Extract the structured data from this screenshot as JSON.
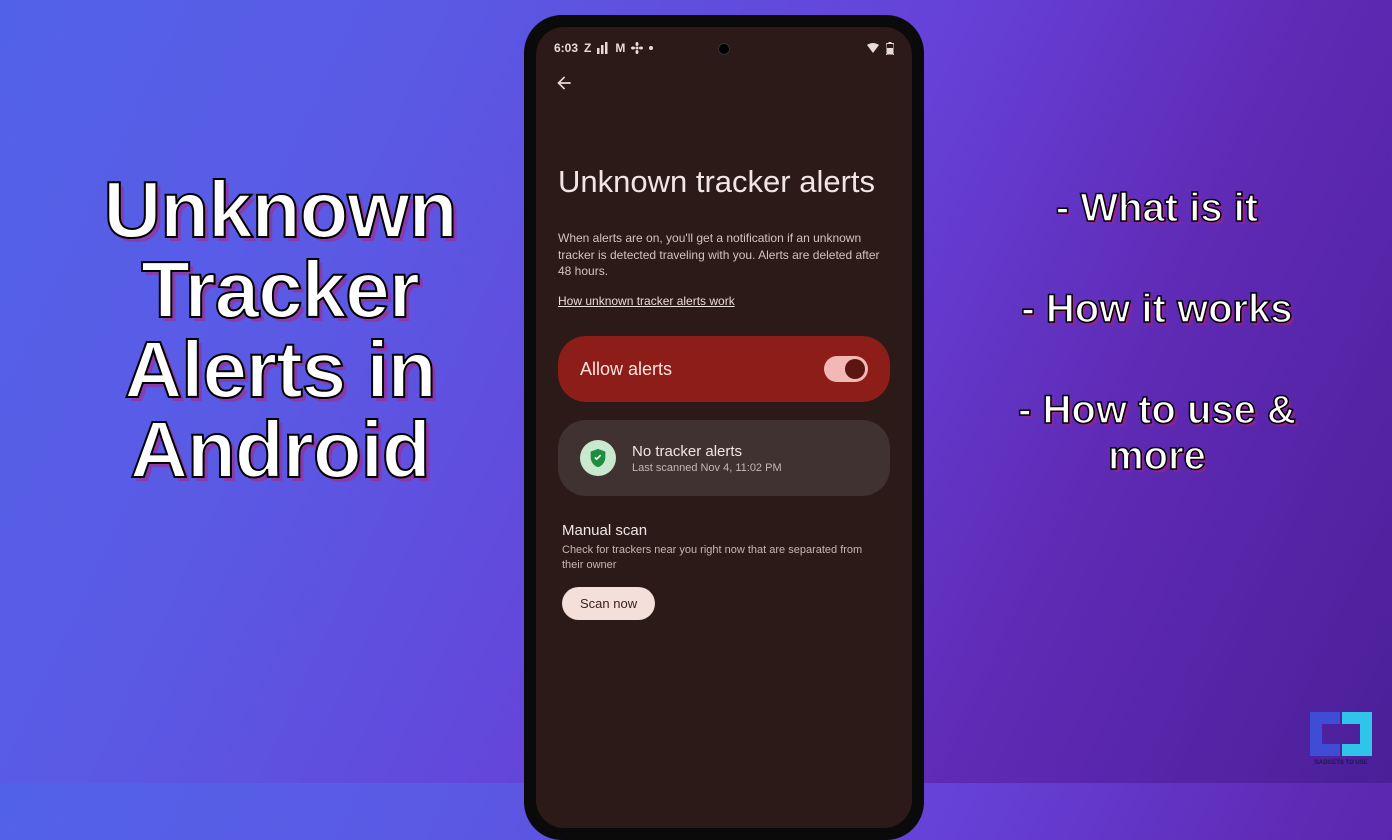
{
  "left_title": "Unknown Tracker Alerts in Android",
  "right_items": [
    "- What is it",
    "- How it works",
    "- How to use & more"
  ],
  "phone": {
    "status": {
      "time": "6:03",
      "icons": "Z",
      "m": "M"
    },
    "page_title": "Unknown tracker alerts",
    "description": "When alerts are on, you'll get a notification if an unknown tracker is detected traveling with you. Alerts are deleted after 48 hours.",
    "link": "How unknown tracker alerts work",
    "allow_label": "Allow alerts",
    "status_card": {
      "title": "No tracker alerts",
      "subtitle": "Last scanned Nov 4, 11:02 PM"
    },
    "manual": {
      "title": "Manual scan",
      "description": "Check for trackers near you right now that are separated from their owner",
      "button": "Scan now"
    }
  },
  "logo_text": "GADGETS TO USE"
}
